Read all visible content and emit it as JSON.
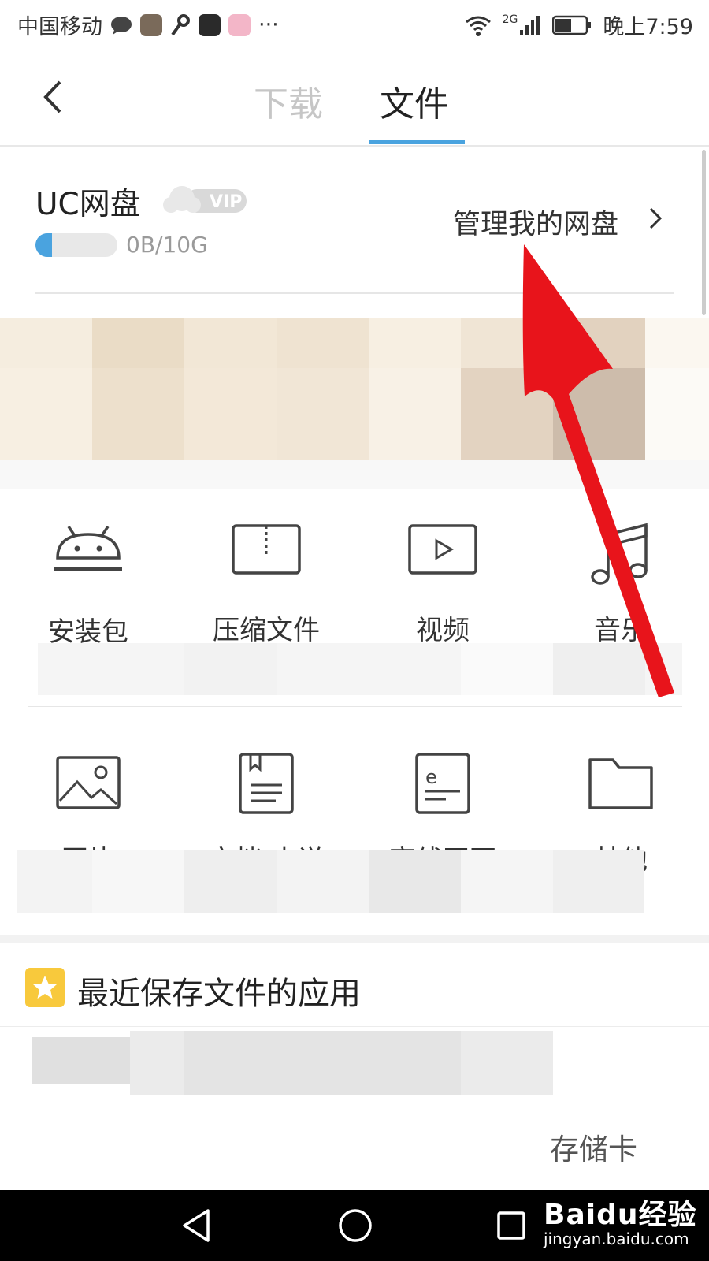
{
  "status_bar": {
    "carrier": "中国移动",
    "more": "···",
    "network": "2G",
    "time": "晚上7:59"
  },
  "header": {
    "tabs": [
      {
        "label": "下载",
        "active": false
      },
      {
        "label": "文件",
        "active": true
      }
    ]
  },
  "cloud_disk": {
    "title": "UC网盘",
    "vip_badge": "VIP",
    "usage_text": "0B/10G",
    "usage_fraction": 0.2,
    "manage_label": "管理我的网盘"
  },
  "categories_row1": [
    {
      "label": "安装包",
      "icon": "android-icon"
    },
    {
      "label": "压缩文件",
      "icon": "zip-archive-icon"
    },
    {
      "label": "视频",
      "icon": "video-play-icon"
    },
    {
      "label": "音乐",
      "icon": "music-note-icon"
    }
  ],
  "categories_row2": [
    {
      "label": "图片",
      "icon": "image-icon"
    },
    {
      "label": "文档/小说",
      "icon": "document-icon"
    },
    {
      "label": "离线网页",
      "icon": "offline-webpage-icon"
    },
    {
      "label": "其他",
      "icon": "folder-icon"
    }
  ],
  "recent": {
    "title": "最近保存文件的应用"
  },
  "storage_label": "存储卡",
  "watermark": {
    "brand": "Baidu经验",
    "url": "jingyan.baidu.com"
  },
  "colors": {
    "accent": "#4aa3df",
    "star": "#f8c93c",
    "arrow": "#e8141b"
  }
}
